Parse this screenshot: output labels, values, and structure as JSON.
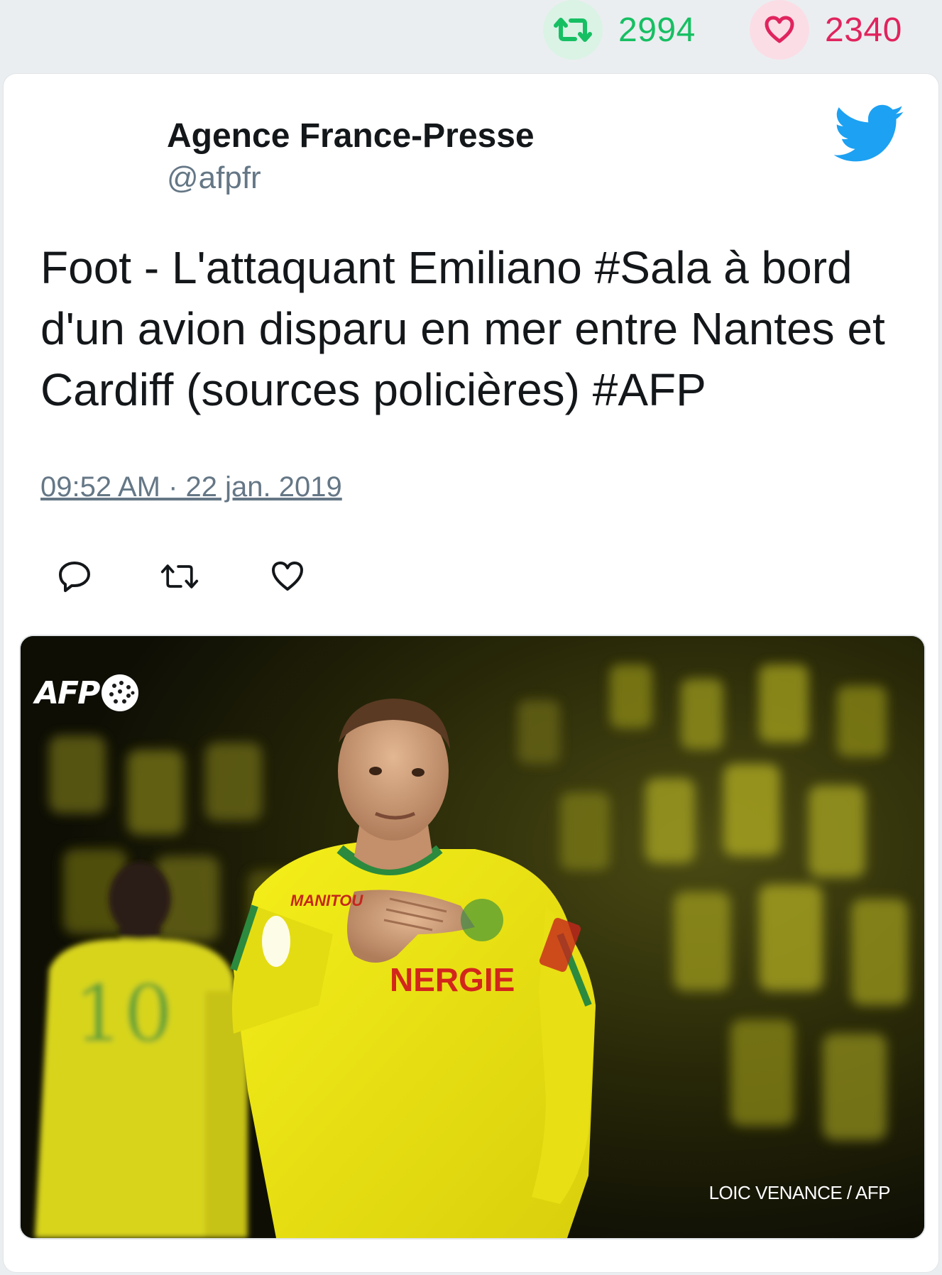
{
  "stats": {
    "retweets": "2994",
    "likes": "2340",
    "retweet_color": "#17bf63",
    "like_color": "#e0245e"
  },
  "tweet": {
    "author_name": "Agence France-Presse",
    "author_handle": "@afpfr",
    "text": "Foot - L'attaquant Emiliano #Sala à bord d'un avion disparu en mer entre Nantes et Cardiff (sources policières) #AFP",
    "timestamp": "09:52 AM · 22 jan. 2019",
    "brand_icon": "twitter-bird-icon",
    "brand_color": "#1da1f2",
    "actions": [
      {
        "name": "reply",
        "icon": "reply-icon"
      },
      {
        "name": "retweet",
        "icon": "retweet-icon"
      },
      {
        "name": "like",
        "icon": "heart-icon"
      }
    ]
  },
  "media": {
    "logo_text": "AFP",
    "credit": "LOIC VENANCE / AFP",
    "jersey_sponsor": "MANITOU",
    "jersey_text": "NERGIE",
    "jersey_number": "10"
  }
}
